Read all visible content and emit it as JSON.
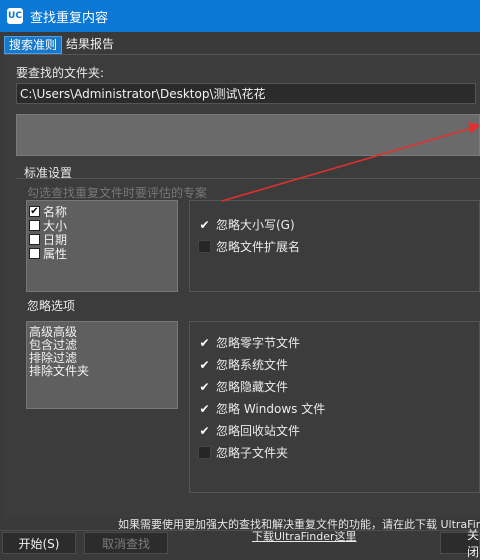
{
  "window": {
    "title": "查找重复内容",
    "app_icon": "UC"
  },
  "tabs": [
    {
      "label": "搜索准则"
    },
    {
      "label": "结果报告"
    }
  ],
  "folder_section": {
    "label": "要查找的文件夹:",
    "path": "C:\\Users\\Administrator\\Desktop\\测试\\花花"
  },
  "standard": {
    "title": "标准设置",
    "hint": "勾选查找重复文件时要评估的专案",
    "criteria": [
      {
        "label": "名称",
        "checked": true
      },
      {
        "label": "大小",
        "checked": false
      },
      {
        "label": "日期",
        "checked": false
      },
      {
        "label": "属性",
        "checked": false
      }
    ],
    "options": [
      {
        "label": "忽略大小写(G)",
        "checked": true
      },
      {
        "label": "忽略文件扩展名",
        "checked": false
      }
    ]
  },
  "ignore": {
    "title": "忽略选项",
    "filters": [
      "高级高级",
      "包含过滤",
      "排除过滤",
      "排除文件夹"
    ],
    "options": [
      {
        "label": "忽略零字节文件",
        "checked": true
      },
      {
        "label": "忽略系统文件",
        "checked": true
      },
      {
        "label": "忽略隐藏文件",
        "checked": true
      },
      {
        "label": "忽略 Windows 文件",
        "checked": true
      },
      {
        "label": "忽略回收站文件",
        "checked": true
      },
      {
        "label": "忽略子文件夹",
        "checked": false
      }
    ]
  },
  "footer": {
    "info": "如果需要使用更加强大的查找和解决重复文件的功能，请在此下载 UltraFinder",
    "link": "下载UltraFinder这里"
  },
  "buttons": {
    "start": "开始(S)",
    "cancel": "取消查找",
    "close": "关闭"
  },
  "colors": {
    "titlebar": "#0a78d4",
    "background": "#3a3a3a",
    "arrow": "#e03030"
  }
}
